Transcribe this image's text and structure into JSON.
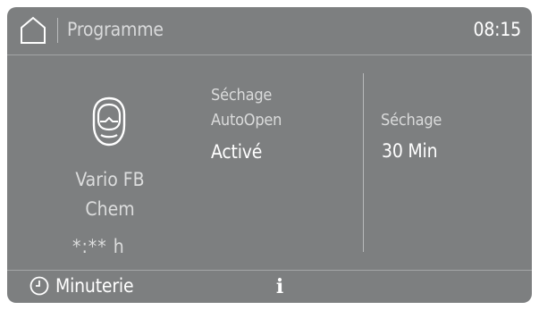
{
  "header": {
    "home_icon": "home-icon",
    "title": "Programme",
    "time": "08:15"
  },
  "program": {
    "icon": "respirator-mask-icon",
    "name_line1": "Vario FB",
    "name_line2": "Chem",
    "duration": "*:** h"
  },
  "options": {
    "autoopen": {
      "label_line1": "Séchage",
      "label_line2": "AutoOpen",
      "value": "Activé"
    },
    "drying": {
      "label": "Séchage",
      "value": "30 Min"
    }
  },
  "footer": {
    "timer_icon": "clock-icon",
    "timer_label": "Minuterie",
    "info_icon": "info-icon",
    "info_glyph": "i"
  },
  "colors": {
    "screen_bg": "#7d7f80",
    "text_primary": "#ffffff",
    "text_secondary": "#dadbdb",
    "divider": "#a3a5a6"
  }
}
